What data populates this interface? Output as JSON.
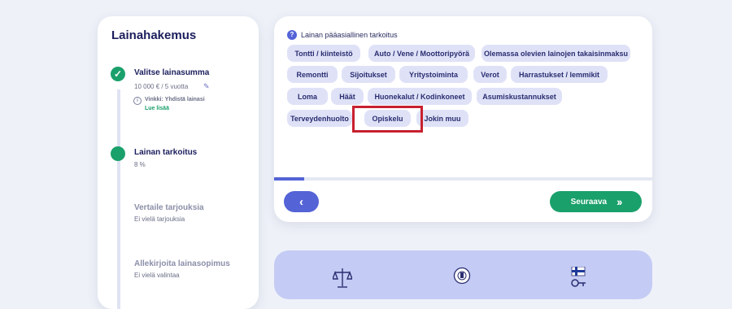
{
  "sidebar": {
    "title": "Lainahakemus",
    "steps": [
      {
        "title": "Valitse lainasumma",
        "sub": "10 000 € / 5 vuotta",
        "state": "done",
        "check": "✓"
      },
      {
        "title": "Lainan tarkoitus",
        "sub": "8 %",
        "state": "active"
      },
      {
        "title": "Vertaile tarjouksia",
        "sub": "Ei vielä tarjouksia",
        "state": "pending"
      },
      {
        "title": "Allekirjoita lainasopimus",
        "sub": "Ei vielä valintaa",
        "state": "pending"
      }
    ],
    "tip": {
      "text": "Vinkki: Yhdistä lainasi",
      "link": "Lue lisää"
    }
  },
  "main": {
    "question": "Lainan pääasiallinen tarkoitus",
    "question_icon": "?",
    "options": [
      "Tontti / kiinteistö",
      "Auto / Vene / Moottoripyörä",
      "Olemassa olevien lainojen takaisinmaksu",
      "Remontti",
      "Sijoitukset",
      "Yritystoiminta",
      "Verot",
      "Harrastukset / lemmikit",
      "Loma",
      "Häät",
      "Huonekalut / Kodinkoneet",
      "Asumiskustannukset",
      "Terveydenhuolto",
      "Opiskelu",
      "Jokin muu"
    ],
    "highlighted_option": "Opiskelu",
    "progress_fraction": 0.08,
    "back_label": "‹",
    "next_label": "Seuraava",
    "next_arrows": "››"
  },
  "colors": {
    "accent": "#5463d6",
    "success": "#1aa06b",
    "chip_bg": "#dfe2f7",
    "highlight": "#c8202f",
    "trust_bg": "#c4cbf4"
  },
  "trust_icons": [
    "scales-icon",
    "seal-icon",
    "finnish-flag-key-icon"
  ]
}
